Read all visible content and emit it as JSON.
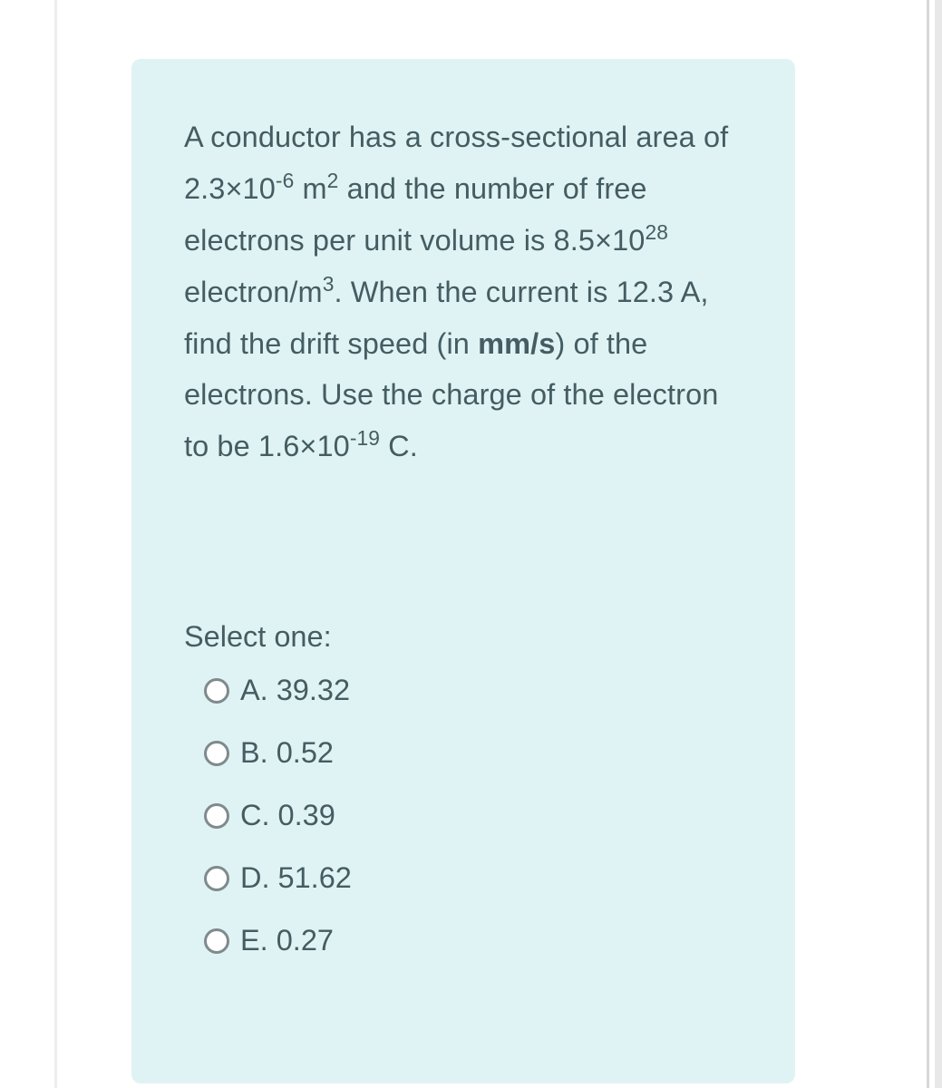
{
  "question": {
    "text_parts": {
      "p1": " A conductor has a cross-sectional area of  2.3×10",
      "sup1": "-6",
      "p2": " m",
      "sup2": "2",
      "p3": " and the number of free electrons per unit volume is 8.5×10",
      "sup3": "28",
      "p4": " electron/m",
      "sup4": "3",
      "p5": ". When the current is 12.3 A, find the drift speed (in ",
      "bold1": "mm/s",
      "p6": ") of the electrons. Use the charge of the electron to be 1.6×10",
      "sup5": "-19",
      "p7": " C."
    },
    "select_label": "Select one:",
    "options": [
      {
        "key": "A",
        "label": "A. 39.32"
      },
      {
        "key": "B",
        "label": "B. 0.52"
      },
      {
        "key": "C",
        "label": "C. 0.39"
      },
      {
        "key": "D",
        "label": "D. 51.62"
      },
      {
        "key": "E",
        "label": "E. 0.27"
      }
    ]
  },
  "colors": {
    "card_bg": "#e0f3f4",
    "text": "#445d62",
    "radio_border": "#7f8a8d"
  }
}
